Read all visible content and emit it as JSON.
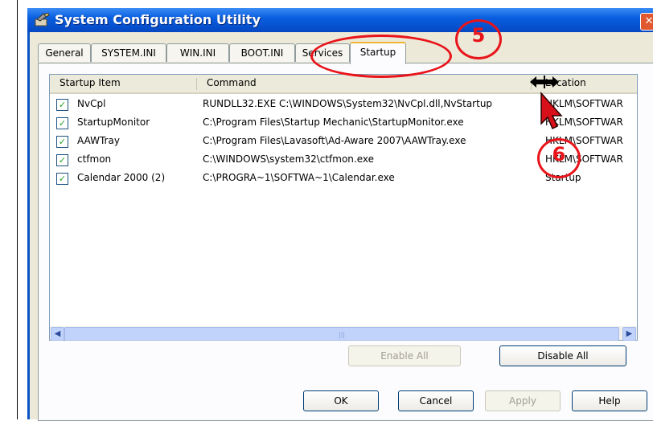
{
  "window": {
    "title": "System Configuration Utility",
    "close_glyph": "✕"
  },
  "tabs": [
    "General",
    "SYSTEM.INI",
    "WIN.INI",
    "BOOT.INI",
    "Services",
    "Startup"
  ],
  "active_tab": "Startup",
  "list": {
    "columns": [
      "Startup Item",
      "Command",
      "Location"
    ],
    "rows": [
      {
        "item": "NvCpl",
        "command": "RUNDLL32.EXE C:\\WINDOWS\\System32\\NvCpl.dll,NvStartup",
        "location": "HKLM\\SOFTWAR",
        "checked": true
      },
      {
        "item": "StartupMonitor",
        "command": "C:\\Program Files\\Startup Mechanic\\StartupMonitor.exe",
        "location": "HKLM\\SOFTWAR",
        "checked": true
      },
      {
        "item": "AAWTray",
        "command": "C:\\Program Files\\Lavasoft\\Ad-Aware 2007\\AAWTray.exe",
        "location": "HKLM\\SOFTWAR",
        "checked": true
      },
      {
        "item": "ctfmon",
        "command": "C:\\WINDOWS\\system32\\ctfmon.exe",
        "location": "HKLM\\SOFTWAR",
        "checked": true
      },
      {
        "item": "Calendar 2000 (2)",
        "command": "C:\\PROGRA~1\\SOFTWA~1\\Calendar.exe",
        "location": "Startup",
        "checked": true
      }
    ]
  },
  "buttons": {
    "enable_all": "Enable All",
    "disable_all": "Disable All",
    "ok": "OK",
    "cancel": "Cancel",
    "apply": "Apply",
    "help": "Help"
  },
  "annotations": {
    "step5": "5",
    "step6": "6"
  },
  "colors": {
    "annotation_red": "#e8141a",
    "title_blue": "#0a5fe0",
    "dialog_bg": "#ece9d8"
  }
}
